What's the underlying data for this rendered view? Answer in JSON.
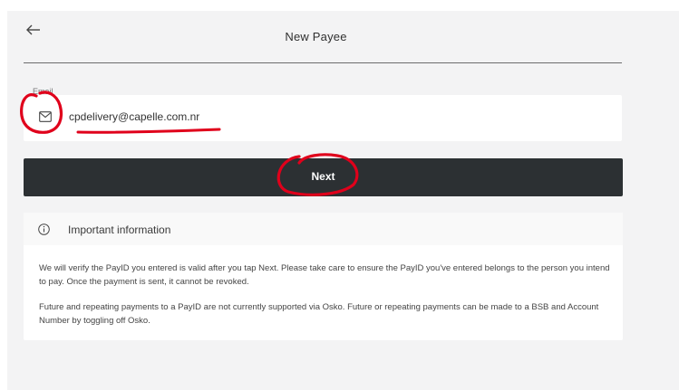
{
  "header": {
    "title": "New Payee",
    "back_icon": "arrow-left-icon"
  },
  "email": {
    "label": "Email",
    "value": "cpdelivery@capelle.com.nr",
    "icon": "mail-icon"
  },
  "next_button": {
    "label": "Next"
  },
  "info": {
    "icon": "info-circle-icon",
    "title": "Important information",
    "paragraph_1": "We will verify the PayID you entered is valid after you tap Next. Please take care to ensure the PayID you've entered belongs to the person you intend to pay. Once the payment is sent, it cannot be revoked.",
    "paragraph_2": "Future and repeating payments to a PayID are not currently supported via Osko. Future or repeating payments can be made to a BSB and Account Number by toggling off Osko."
  },
  "colors": {
    "annotation_red": "#e0001b",
    "button_dark": "#2c3033",
    "page_bg": "#f3f3f4"
  }
}
